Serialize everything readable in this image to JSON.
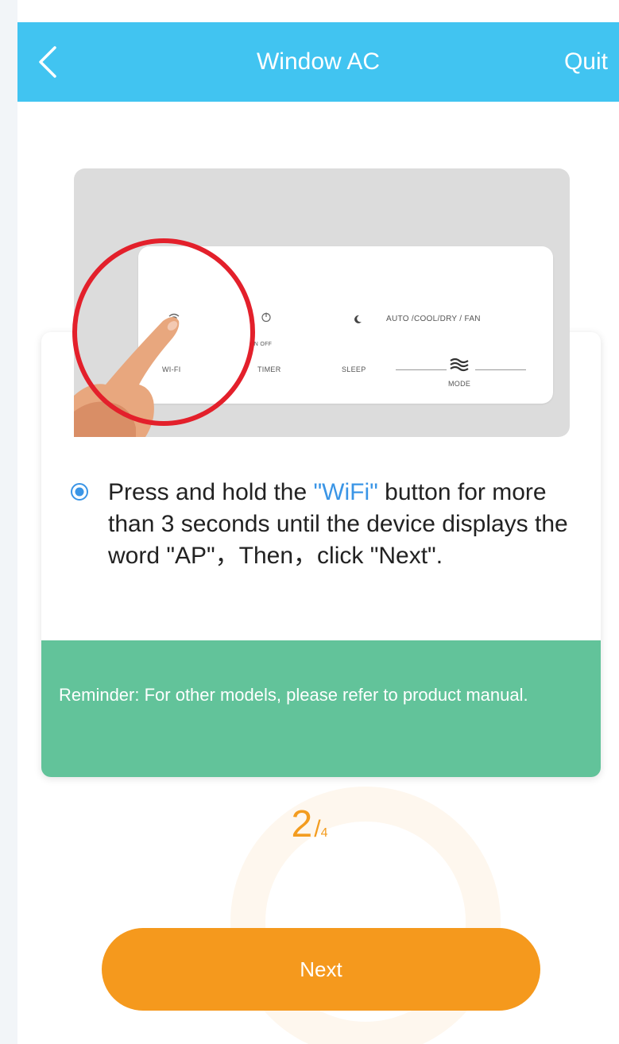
{
  "header": {
    "title": "Window AC",
    "quit_label": "Quit"
  },
  "illustration": {
    "labels": {
      "wifi": "WI-FI",
      "on_off": "ON OFF",
      "timer": "TIMER",
      "sleep": "SLEEP",
      "mode": "MODE",
      "modes": "AUTO /COOL/DRY / FAN"
    }
  },
  "instruction": {
    "part1": "Press and hold the ",
    "highlight": "\"WiFi\"",
    "part2": " button for more than 3 seconds until the device displays the word \"AP\"，Then，click \"Next\"."
  },
  "reminder": {
    "text": "Reminder: For other models, please refer to product manual."
  },
  "step": {
    "current": "2",
    "separator": "/",
    "total": "4"
  },
  "next_button": {
    "label": "Next"
  },
  "colors": {
    "header": "#41c4f1",
    "reminder": "#62c39a",
    "accent_orange": "#f5991d",
    "highlight_blue": "#3a95e6",
    "circle_red": "#e3202b"
  }
}
